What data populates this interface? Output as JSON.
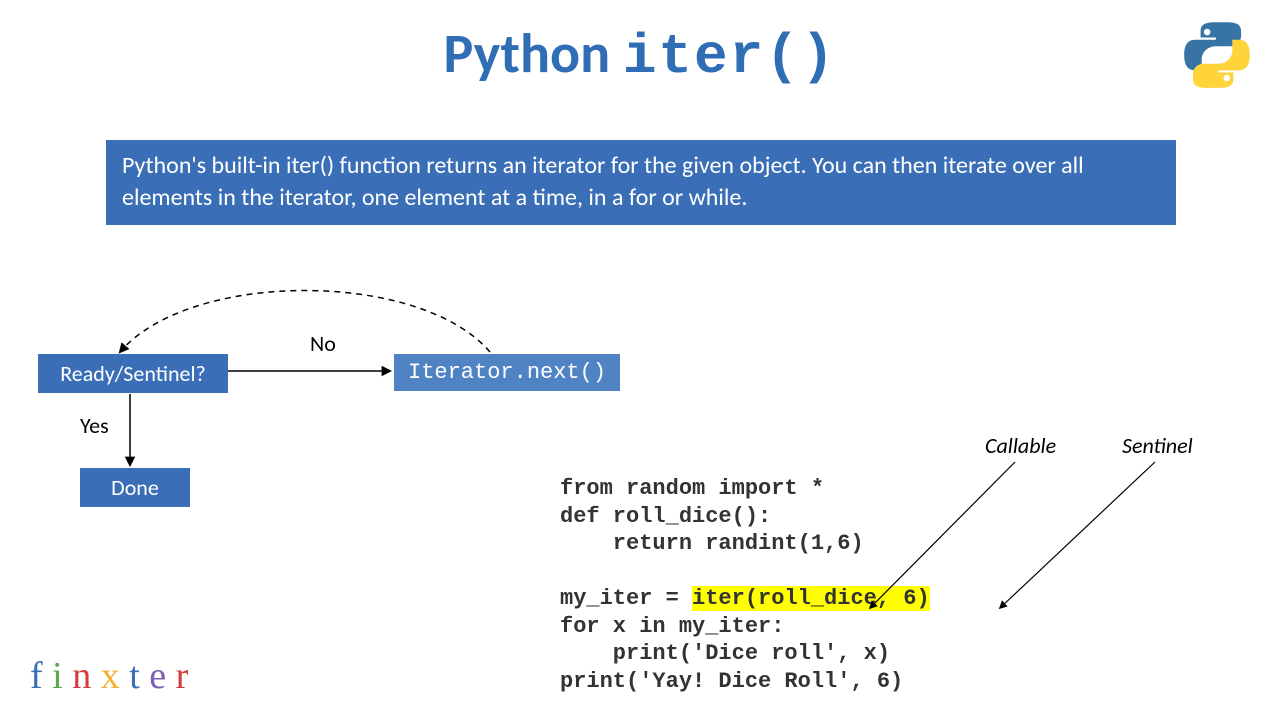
{
  "title": {
    "word1": "Python",
    "word2": "iter()"
  },
  "description": "Python's built-in iter() function returns an iterator for the given object. You can then iterate over all elements in the iterator, one element at a time, in a for or while.",
  "flow": {
    "decision": "Ready/Sentinel?",
    "next_call": "Iterator.next()",
    "done": "Done",
    "no_label": "No",
    "yes_label": "Yes"
  },
  "annotations": {
    "callable": "Callable",
    "sentinel": "Sentinel"
  },
  "code": {
    "line1": "from random import *",
    "line2": "def roll_dice():",
    "line3": "    return randint(1,6)",
    "line4": "",
    "line5a": "my_iter = ",
    "line5b": "iter(roll_dice, 6)",
    "line6": "for x in my_iter:",
    "line7": "    print('Dice roll', x)",
    "line8": "print('Yay! Dice Roll', 6)"
  },
  "brand": {
    "f": "f",
    "i": "i",
    "n": "n",
    "x": "x",
    "t": "t",
    "e": "e",
    "r": "r"
  }
}
